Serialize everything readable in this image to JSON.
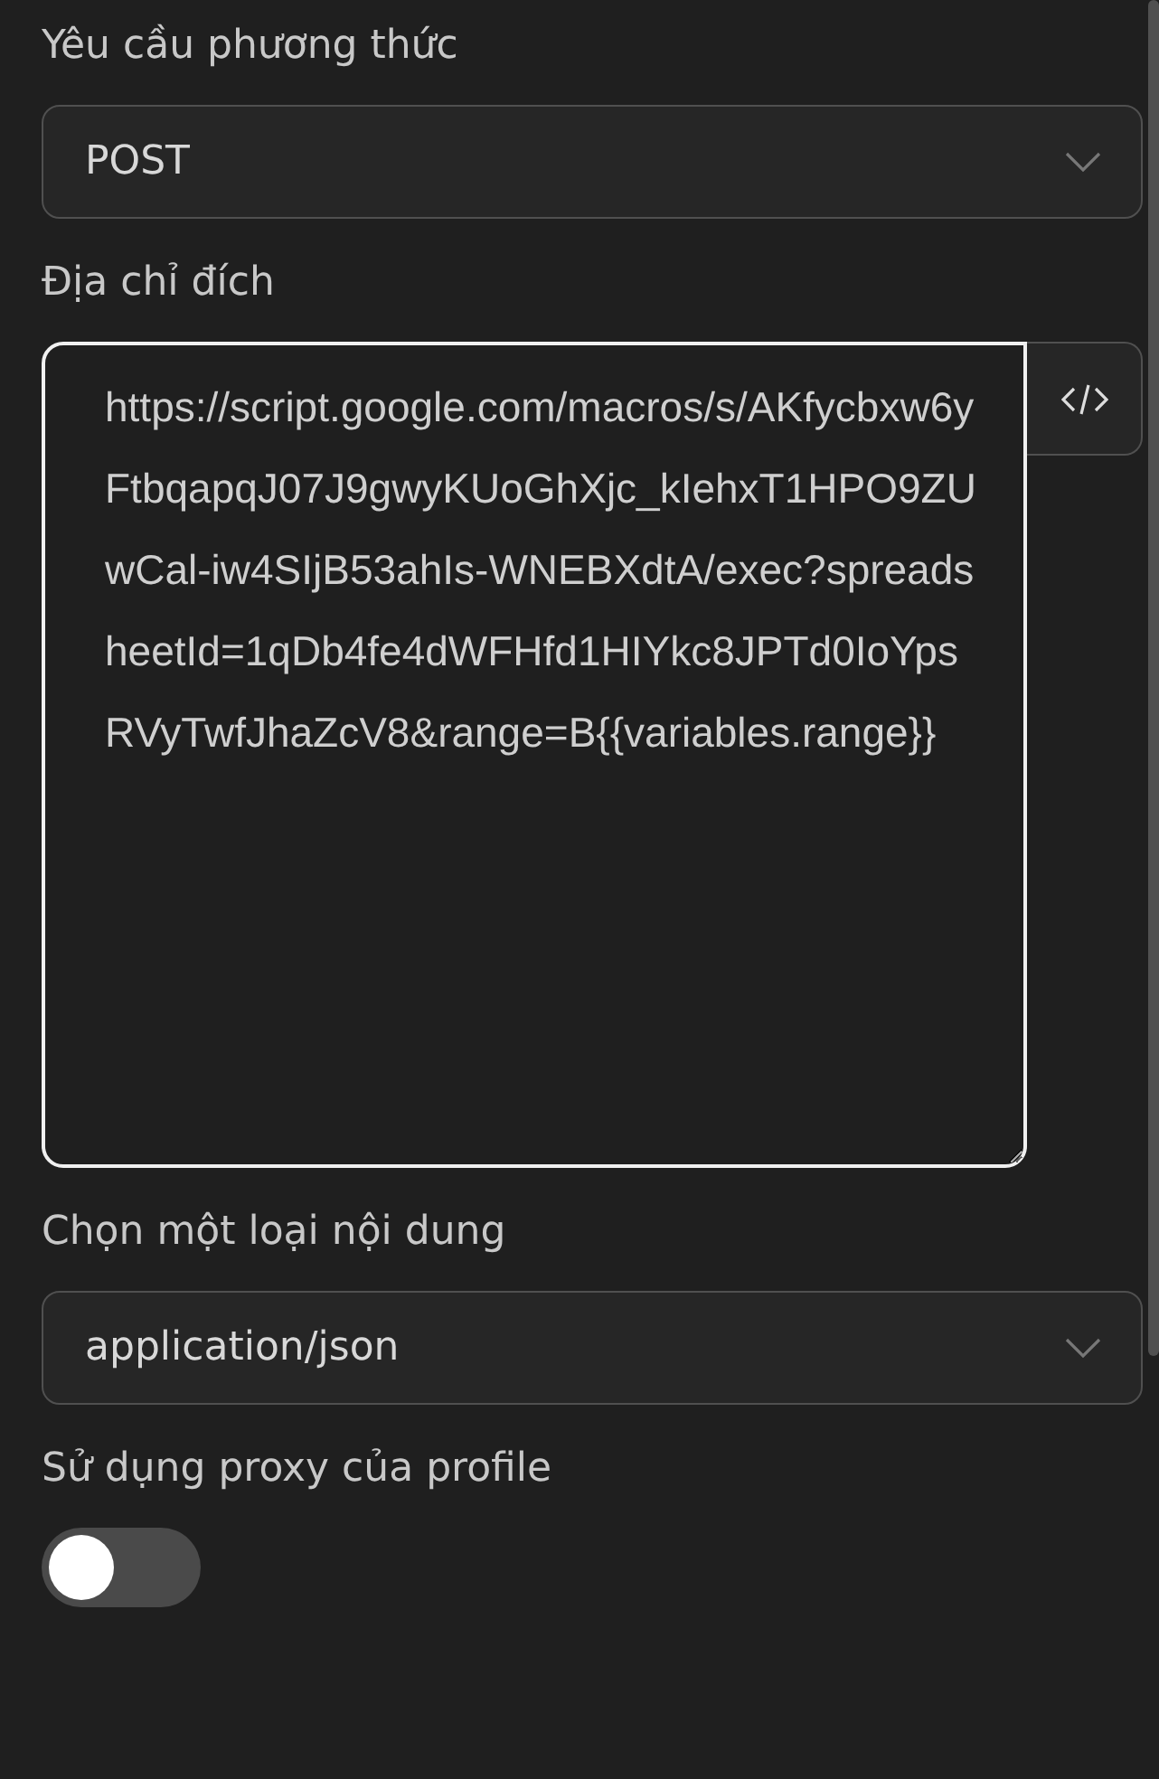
{
  "fields": [
    {
      "kind": "select",
      "label": "Yêu cầu phương thức",
      "value": "POST"
    },
    {
      "kind": "textarea",
      "label": "Địa chỉ đích",
      "value": "https://script.google.com/macros/s/AKfycbxw6yFtbqapqJ07J9gwyKUoGhXjc_kIehxT1HPO9ZUwCal-iw4SIjB53ahIs-WNEBXdtA/exec?spreadsheetId=1qDb4fe4dWFHfd1HIYkc8JPTd0IoYpsRVyTwfJhaZcV8&range=B{{variables.range}}"
    },
    {
      "kind": "select",
      "label": "Chọn một loại nội dung",
      "value": "application/json"
    },
    {
      "kind": "toggle",
      "label": "Sử dụng proxy của profile",
      "on": false
    }
  ]
}
